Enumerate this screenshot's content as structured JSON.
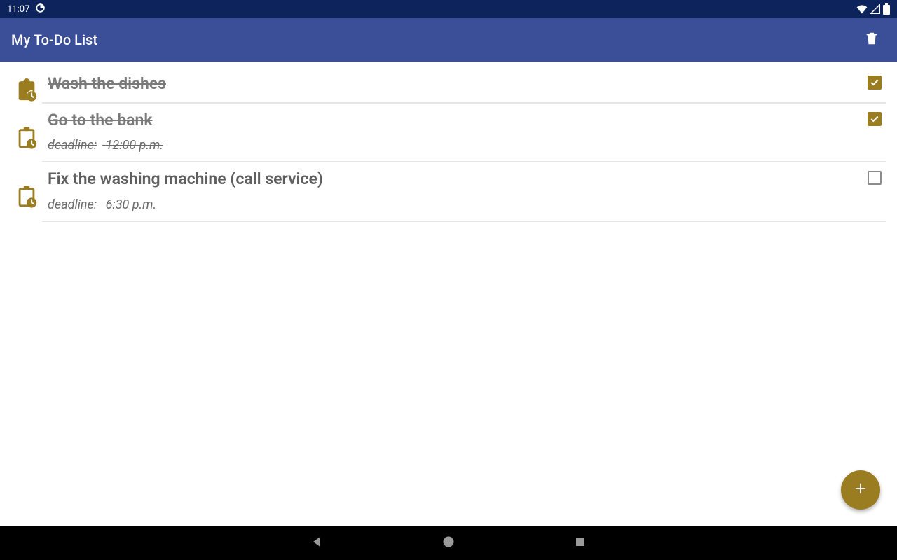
{
  "status": {
    "time": "11:07"
  },
  "app": {
    "title": "My To-Do List"
  },
  "deadline_label": "deadline:",
  "items": [
    {
      "title": "Wash the dishes",
      "deadline": "",
      "done": true
    },
    {
      "title": "Go to the bank",
      "deadline": "12:00 p.m.",
      "done": true
    },
    {
      "title": "Fix the washing machine (call service)",
      "deadline": "6:30 p.m.",
      "done": false
    }
  ],
  "colors": {
    "status_bar": "#0c235b",
    "app_bar": "#3b4f98",
    "accent": "#9b7d21"
  }
}
